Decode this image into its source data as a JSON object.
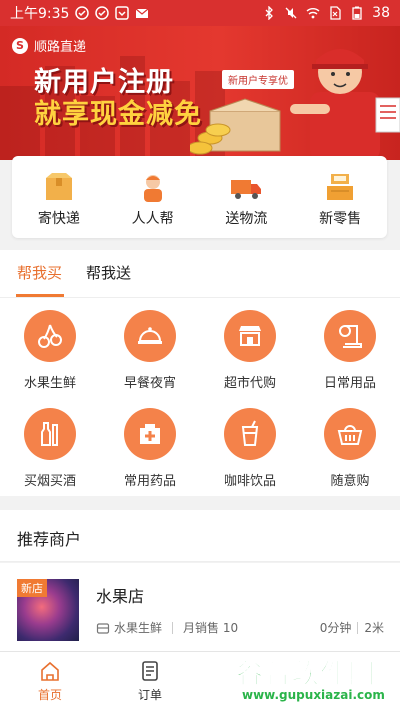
{
  "status_bar": {
    "time": "上午9:35",
    "battery": "38"
  },
  "banner": {
    "brand_name": "顺路直递",
    "promo_line1": "新用户注册",
    "promo_line2": "就享现金减免",
    "tag": "新用户专享优"
  },
  "services": [
    {
      "label": "寄快递",
      "icon": "package-box-icon"
    },
    {
      "label": "人人帮",
      "icon": "courier-person-icon"
    },
    {
      "label": "送物流",
      "icon": "delivery-truck-icon"
    },
    {
      "label": "新零售",
      "icon": "retail-register-icon"
    }
  ],
  "tabs": [
    {
      "label": "帮我买",
      "active": true
    },
    {
      "label": "帮我送",
      "active": false
    }
  ],
  "categories": [
    {
      "name": "水果生鲜",
      "icon": "cherry-icon"
    },
    {
      "name": "早餐夜宵",
      "icon": "food-cloche-icon"
    },
    {
      "name": "超市代购",
      "icon": "store-icon"
    },
    {
      "name": "日常用品",
      "icon": "tissue-roll-icon"
    },
    {
      "name": "买烟买酒",
      "icon": "bottle-cigarette-icon"
    },
    {
      "name": "常用药品",
      "icon": "medicine-box-icon"
    },
    {
      "name": "咖啡饮品",
      "icon": "drink-cup-icon"
    },
    {
      "name": "随意购",
      "icon": "shopping-basket-icon"
    }
  ],
  "recommend": {
    "title": "推荐商户",
    "merchant": {
      "badge": "新店",
      "name": "水果店",
      "category": "水果生鲜",
      "sales": "月销售 10",
      "time": "0分钟",
      "distance": "2米"
    }
  },
  "bottom_nav": [
    {
      "label": "首页",
      "active": true,
      "icon": "home-icon"
    },
    {
      "label": "订单",
      "active": false,
      "icon": "order-list-icon"
    }
  ],
  "watermark": {
    "text": "谷普软件园",
    "url": "www.gupuxiazai.com"
  },
  "colors": {
    "brand_red": "#d9302f",
    "accent_orange": "#f07a33",
    "category_circle": "#f4824a"
  }
}
